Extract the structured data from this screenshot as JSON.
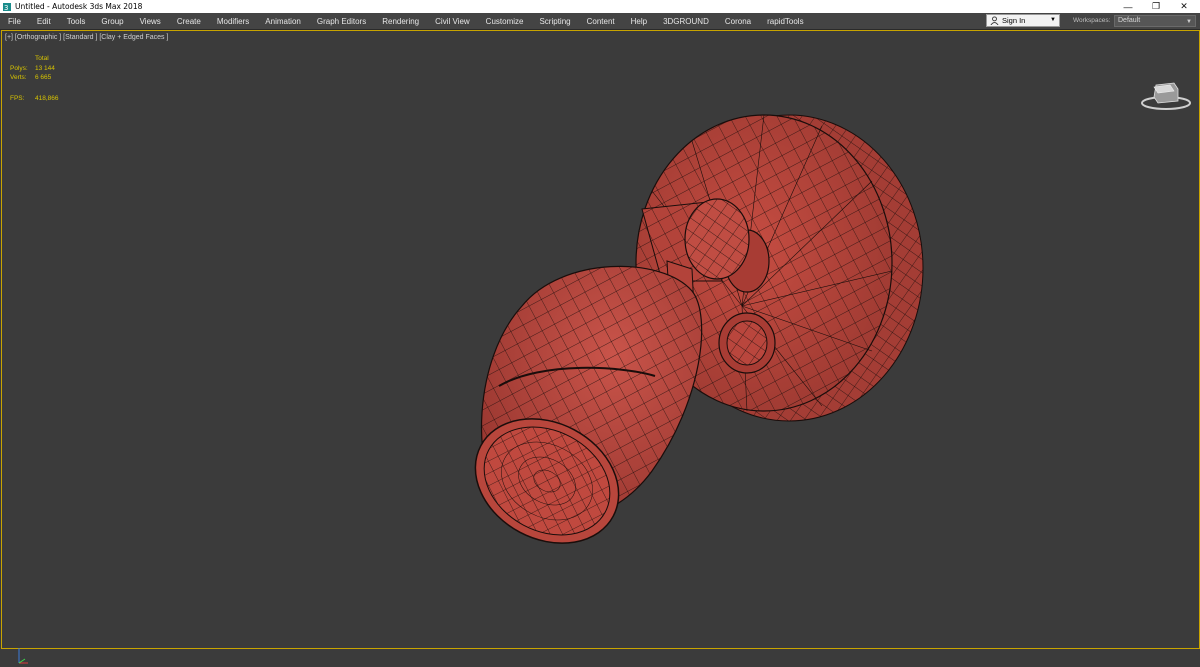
{
  "window": {
    "title": "Untitled - Autodesk 3ds Max 2018",
    "controls": {
      "minimize": "—",
      "restore": "❐",
      "close": "✕"
    }
  },
  "menu": [
    "File",
    "Edit",
    "Tools",
    "Group",
    "Views",
    "Create",
    "Modifiers",
    "Animation",
    "Graph Editors",
    "Rendering",
    "Civil View",
    "Customize",
    "Scripting",
    "Content",
    "Help",
    "3DGROUND",
    "Corona",
    "rapidTools"
  ],
  "signin": {
    "label": "Sign In"
  },
  "workspaces": {
    "label": "Workspaces:",
    "value": "Default"
  },
  "viewport": {
    "label": "[+] [Orthographic ] [Standard ] [Clay + Edged Faces ]",
    "stats": {
      "header": "Total",
      "polys_label": "Polys:",
      "polys_value": "13 144",
      "verts_label": "Verts:",
      "verts_value": "6 665",
      "fps_label": "FPS:",
      "fps_value": "418,866"
    },
    "object_color": "#b5443b",
    "wire_color": "#1a0d0b",
    "border_color": "#c8a400"
  }
}
